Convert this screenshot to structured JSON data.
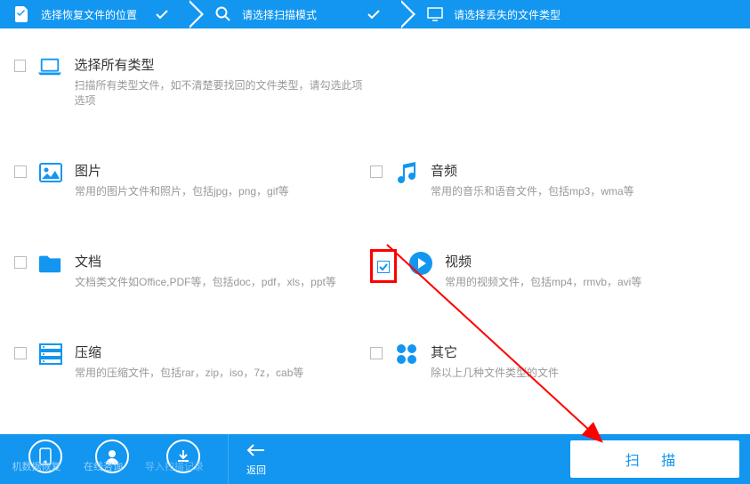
{
  "steps": {
    "s1": "选择恢复文件的位置",
    "s2": "请选择扫描模式",
    "s3": "请选择丢失的文件类型"
  },
  "types": {
    "all": {
      "title": "选择所有类型",
      "desc": "扫描所有类型文件，如不清楚要找回的文件类型，请勾选此项选项"
    },
    "image": {
      "title": "图片",
      "desc": "常用的图片文件和照片，包括jpg，png，gif等"
    },
    "audio": {
      "title": "音频",
      "desc": "常用的音乐和语音文件，包括mp3，wma等"
    },
    "doc": {
      "title": "文档",
      "desc": "文档类文件如Office,PDF等，包括doc，pdf，xls，ppt等"
    },
    "video": {
      "title": "视频",
      "desc": "常用的视频文件，包括mp4，rmvb，avi等"
    },
    "zip": {
      "title": "压缩",
      "desc": "常用的压缩文件，包括rar，zip，iso，7z，cab等"
    },
    "other": {
      "title": "其它",
      "desc": "除以上几种文件类型的文件"
    }
  },
  "bottom": {
    "b1": "机数据恢复",
    "b2": "在线咨询",
    "b3": "导入扫描记录",
    "back": "返回",
    "scan": "扫 描"
  }
}
